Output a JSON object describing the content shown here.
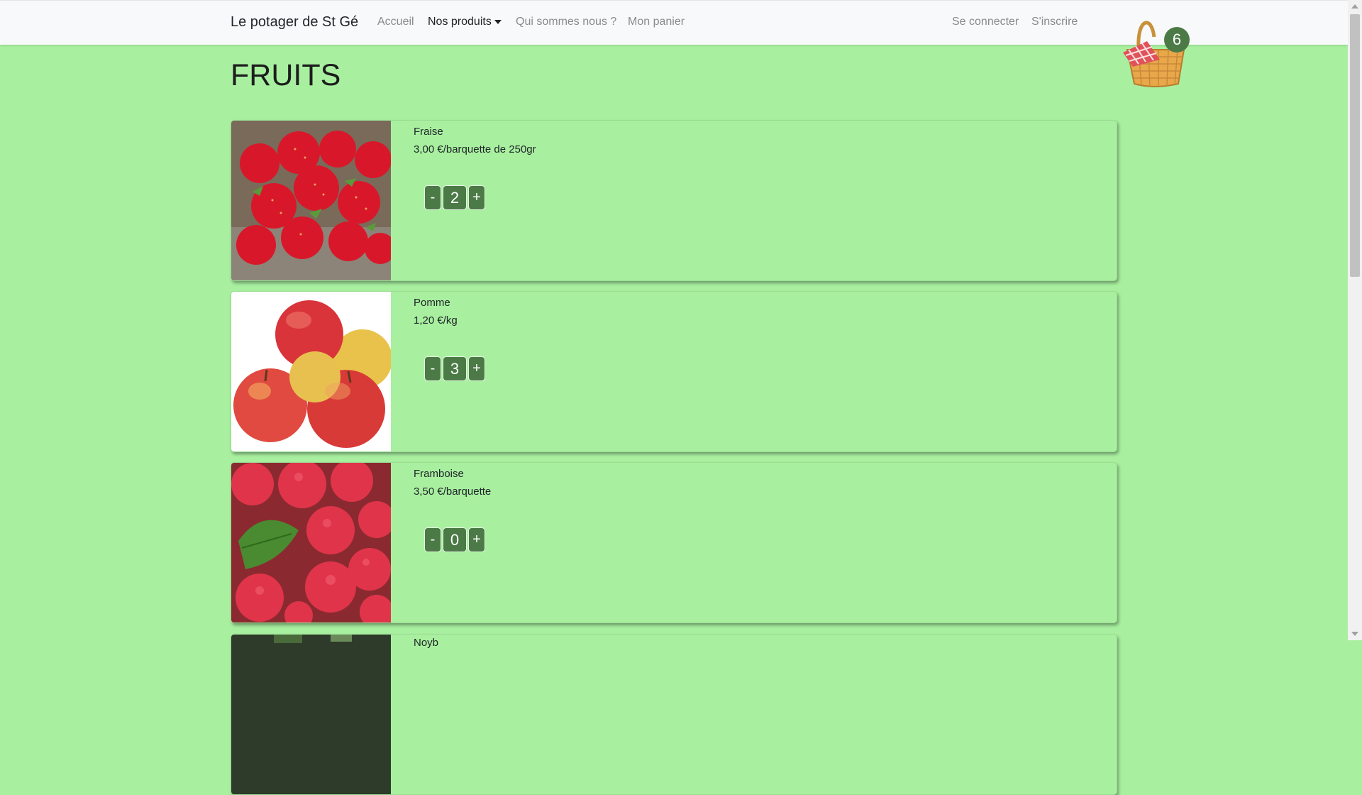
{
  "navbar": {
    "brand": "Le potager de St Gé",
    "links": [
      "Accueil",
      "Nos produits",
      "Qui sommes nous ?",
      "Mon panier"
    ],
    "right_links": [
      "Se connecter",
      "S'inscrire"
    ],
    "basket_count": "6"
  },
  "page": {
    "title": "FRUITS"
  },
  "products": [
    {
      "name": "Fraise",
      "price": "3,00 €/barquette de 250gr",
      "quantity": "2",
      "minus": "-",
      "plus": "+"
    },
    {
      "name": "Pomme",
      "price": "1,20 €/kg",
      "quantity": "3",
      "minus": "-",
      "plus": "+"
    },
    {
      "name": "Framboise",
      "price": "3,50 €/barquette",
      "quantity": "0",
      "minus": "-",
      "plus": "+"
    },
    {
      "name": "Noyb"
    }
  ],
  "colors": {
    "background": "#a8f0a0",
    "accent": "#4c7a47",
    "navbar": "#f8f9fa"
  }
}
